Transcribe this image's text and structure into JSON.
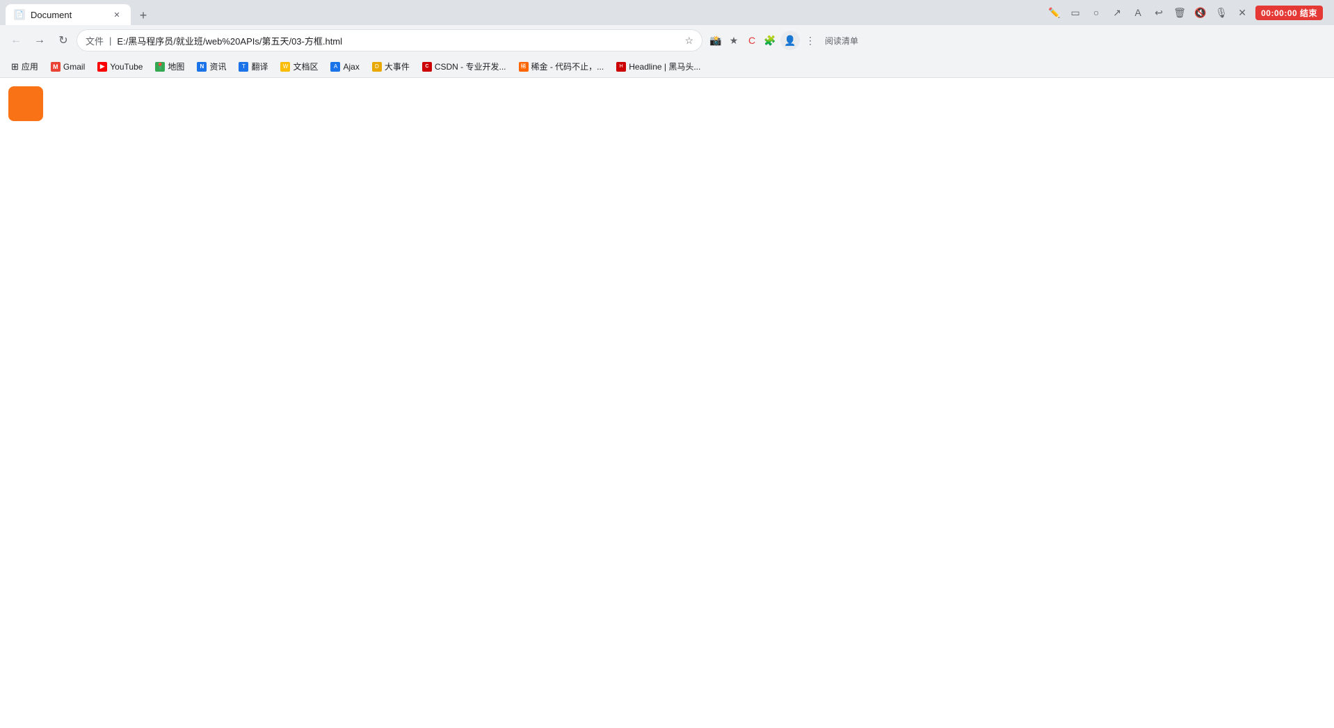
{
  "browser": {
    "tab": {
      "title": "Document",
      "favicon_color": "#e8eaed"
    },
    "new_tab_label": "+",
    "address_bar": {
      "prefix": "文件",
      "url": "E:/黑马程序员/就业班/web%20APIs/第五天/03-方框.html"
    },
    "timer": "00:00:00 结束",
    "toolbar_icons": [
      "edit-icon",
      "rectangle-icon",
      "circle-icon",
      "arrow-icon",
      "text-icon",
      "undo-icon",
      "trash-icon",
      "mute-icon",
      "mic-icon",
      "close-icon"
    ],
    "bookmarks": [
      {
        "id": "apps",
        "label": "应用",
        "icon_color": "#5f6368"
      },
      {
        "id": "gmail",
        "label": "Gmail",
        "icon_color": "#ea4335"
      },
      {
        "id": "youtube",
        "label": "YouTube",
        "icon_color": "#ff0000"
      },
      {
        "id": "maps",
        "label": "地图",
        "icon_color": "#34a853"
      },
      {
        "id": "news",
        "label": "资讯",
        "icon_color": "#1a73e8"
      },
      {
        "id": "translate",
        "label": "翻译",
        "icon_color": "#1a73e8"
      },
      {
        "id": "wenquka",
        "label": "文档区",
        "icon_color": "#fbbc04"
      },
      {
        "id": "ajax",
        "label": "Ajax",
        "icon_color": "#1a73e8"
      },
      {
        "id": "dashijian",
        "label": "大事件",
        "icon_color": "#e8a800"
      },
      {
        "id": "csdn",
        "label": "CSDN - 专业开发...",
        "icon_color": "#c00"
      },
      {
        "id": "hejin",
        "label": "稀金 - 代码不止，...",
        "icon_color": "#f60"
      },
      {
        "id": "headline",
        "label": "Headline | 黑马头...",
        "icon_color": "#c00"
      }
    ],
    "reading_mode_label": "阅读清单",
    "nav_right_icons": [
      "star-icon",
      "pdf-icon",
      "extensions-icon",
      "account-icon",
      "menu-icon"
    ]
  },
  "page": {
    "box_color": "#f97316",
    "box_border_radius": "8px"
  }
}
